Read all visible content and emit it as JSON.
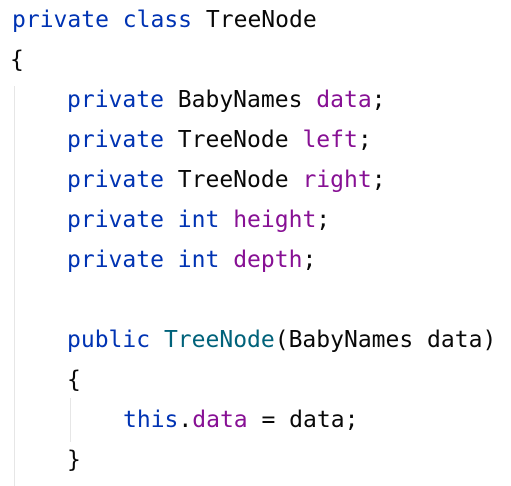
{
  "code": {
    "line1": {
      "kw1": "private",
      "kw2": "class",
      "name": "TreeNode"
    },
    "line2": {
      "brace": "{"
    },
    "line3": {
      "kw": "private",
      "type": "BabyNames",
      "field": "data",
      "semi": ";"
    },
    "line4": {
      "kw": "private",
      "type": "TreeNode",
      "field": "left",
      "semi": ";"
    },
    "line5": {
      "kw": "private",
      "type": "TreeNode",
      "field": "right",
      "semi": ";"
    },
    "line6": {
      "kw": "private",
      "type": "int",
      "field": "height",
      "semi": ";"
    },
    "line7": {
      "kw": "private",
      "type": "int",
      "field": "depth",
      "semi": ";"
    },
    "line9": {
      "kw": "public",
      "method": "TreeNode",
      "params": "(BabyNames data)"
    },
    "line10": {
      "brace": "{"
    },
    "line11": {
      "this": "this",
      "dot": ".",
      "field": "data",
      "rest": " = data;"
    },
    "line12": {
      "brace": "}"
    }
  },
  "colors": {
    "keyword": "#0033b3",
    "field": "#871094",
    "method": "#00627a",
    "text": "#080808",
    "background": "#ffffff"
  }
}
